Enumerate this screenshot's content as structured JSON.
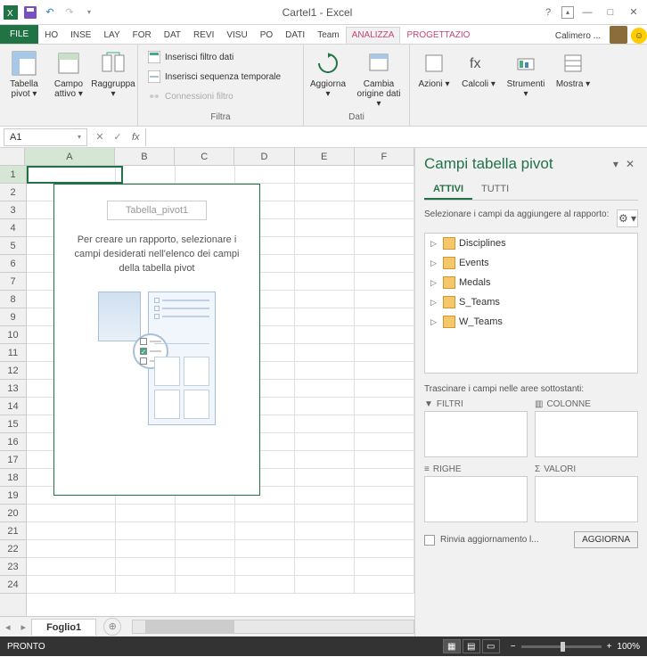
{
  "title": "Cartel1 - Excel",
  "account": "Calimero ...",
  "tabs": [
    "FILE",
    "HO",
    "INSE",
    "LAY",
    "FOR",
    "DAT",
    "REVI",
    "VISU",
    "PO",
    "DATI",
    "Team",
    "ANALIZZA",
    "PROGETTAZIO"
  ],
  "active_tab": "ANALIZZA",
  "ribbon": {
    "groups": [
      {
        "label": "",
        "big": [
          {
            "label": "Tabella pivot ▾"
          },
          {
            "label": "Campo attivo ▾"
          },
          {
            "label": "Raggruppa ▾"
          }
        ]
      },
      {
        "label": "Filtra",
        "small": [
          {
            "label": "Inserisci filtro dati"
          },
          {
            "label": "Inserisci sequenza temporale"
          },
          {
            "label": "Connessioni filtro",
            "disabled": true
          }
        ]
      },
      {
        "label": "Dati",
        "big": [
          {
            "label": "Aggiorna ▾"
          },
          {
            "label": "Cambia origine dati ▾"
          }
        ]
      },
      {
        "label": "",
        "big": [
          {
            "label": "Azioni ▾"
          },
          {
            "label": "Calcoli ▾"
          },
          {
            "label": "Strumenti ▾"
          },
          {
            "label": "Mostra ▾"
          }
        ]
      }
    ]
  },
  "namebox": "A1",
  "columns": [
    "A",
    "B",
    "C",
    "D",
    "E",
    "F"
  ],
  "rows": [
    "1",
    "2",
    "3",
    "4",
    "5",
    "6",
    "7",
    "8",
    "9",
    "10",
    "11",
    "12",
    "13",
    "14",
    "15",
    "16",
    "17",
    "18",
    "19",
    "20",
    "21",
    "22",
    "23",
    "24"
  ],
  "pivot_placeholder": {
    "title": "Tabella_pivot1",
    "text": "Per creare un rapporto, selezionare i campi desiderati nell'elenco dei campi della tabella pivot"
  },
  "fieldpane": {
    "title": "Campi tabella pivot",
    "tabs": {
      "active": "ATTIVI",
      "all": "TUTTI"
    },
    "instr": "Selezionare i campi da aggiungere al rapporto:",
    "fields": [
      "Disciplines",
      "Events",
      "Medals",
      "S_Teams",
      "W_Teams"
    ],
    "drag_instr": "Trascinare i campi nelle aree sottostanti:",
    "areas": {
      "filters": "FILTRI",
      "columns": "COLONNE",
      "rows": "RIGHE",
      "values": "VALORI"
    },
    "defer": "Rinvia aggiornamento l...",
    "update": "AGGIORNA"
  },
  "sheet_tab": "Foglio1",
  "status": "PRONTO",
  "zoom": "100%"
}
